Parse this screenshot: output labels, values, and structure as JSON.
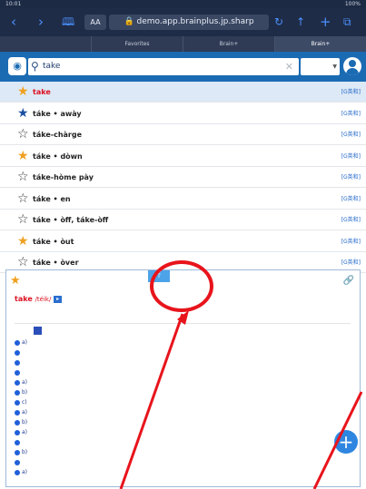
{
  "status_bar": {
    "time": "10:01",
    "battery": "100%"
  },
  "browser": {
    "url": "demo.app.brainplus.jp.sharp",
    "reader_label": "AA",
    "tabs": [
      {
        "label": ""
      },
      {
        "label": "Favorites"
      },
      {
        "label": "Brain+"
      },
      {
        "label": "Brain+",
        "active": true
      }
    ]
  },
  "app": {
    "search": {
      "query": "take",
      "placeholder": ""
    },
    "mode_label": "",
    "results": [
      {
        "word": "take",
        "tag": "[G英和]",
        "starred": true,
        "star_color": "#f0a020",
        "selected": true,
        "word_color": "#d12"
      },
      {
        "word": "táke • awày",
        "tag": "[G英和]",
        "starred": true,
        "star_color": "#1a4fa3"
      },
      {
        "word": "táke-chàrge",
        "tag": "[G英和]",
        "starred": false
      },
      {
        "word": "táke • dòwn",
        "tag": "[G英和]",
        "starred": true,
        "star_color": "#f0a020"
      },
      {
        "word": "táke-hòme pày",
        "tag": "[G英和]",
        "starred": false
      },
      {
        "word": "táke • en",
        "tag": "[G英和]",
        "starred": false
      },
      {
        "word": "táke • òff, táke-òff",
        "tag": "[G英和]",
        "starred": false
      },
      {
        "word": "táke • òut",
        "tag": "[G英和]",
        "starred": true,
        "star_color": "#f0a020"
      },
      {
        "word": "táke • òver",
        "tag": "[G英和]",
        "starred": false
      }
    ],
    "detail": {
      "headword": "take",
      "pron": "/téik/",
      "collapse_icon": "collapse-arrow-icon",
      "senses": [
        {
          "text": "a)"
        },
        {
          "text": ""
        },
        {
          "text": ""
        },
        {
          "text": ""
        },
        {
          "text": "a)"
        },
        {
          "text": "b)"
        },
        {
          "text": "c)"
        },
        {
          "text": "a)"
        },
        {
          "text": "b)"
        },
        {
          "text": "a)"
        },
        {
          "text": ""
        },
        {
          "text": "b)"
        },
        {
          "text": ""
        },
        {
          "text": "a)"
        }
      ]
    }
  },
  "colors": {
    "brand": "#1b6bb3",
    "annotation": "#e8141c"
  }
}
